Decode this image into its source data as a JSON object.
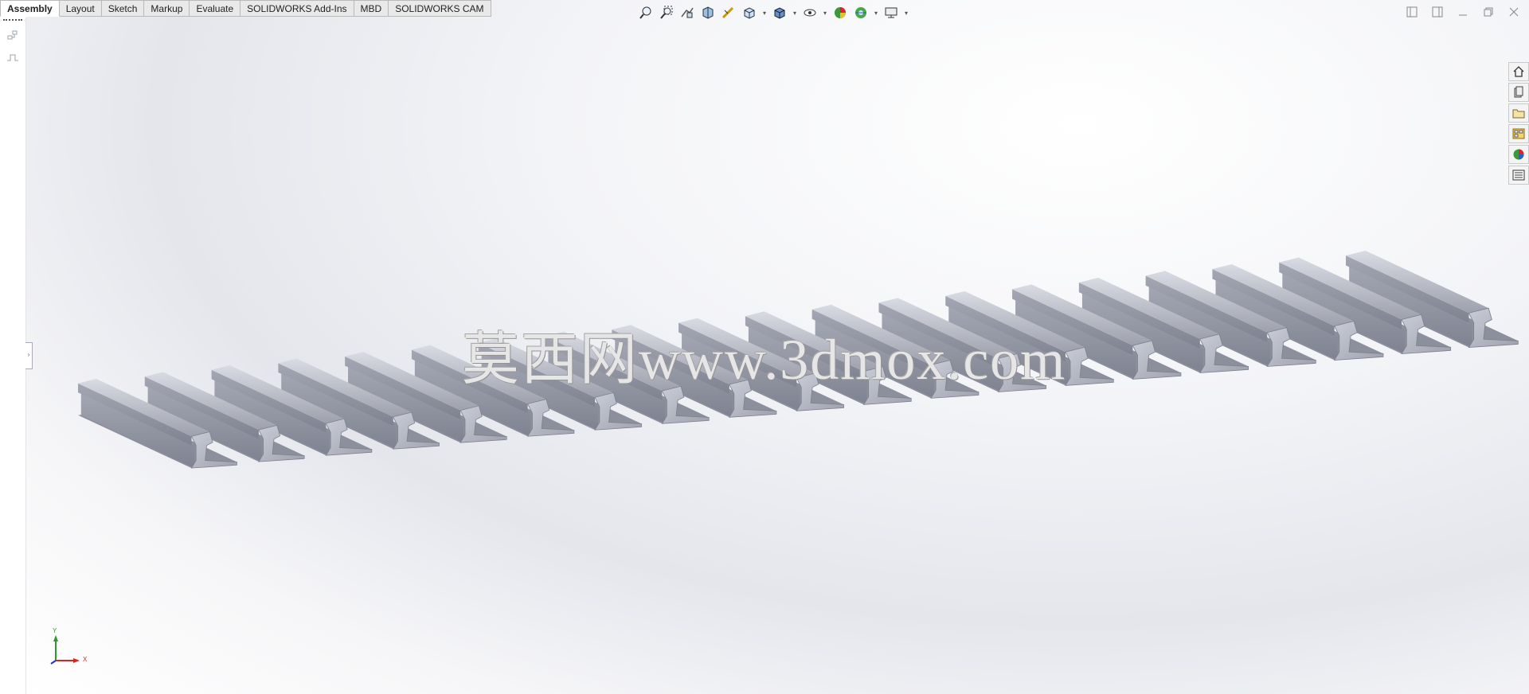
{
  "tabs": [
    {
      "label": "Assembly",
      "active": true
    },
    {
      "label": "Layout",
      "active": false
    },
    {
      "label": "Sketch",
      "active": false
    },
    {
      "label": "Markup",
      "active": false
    },
    {
      "label": "Evaluate",
      "active": false
    },
    {
      "label": "SOLIDWORKS Add-Ins",
      "active": false
    },
    {
      "label": "MBD",
      "active": false
    },
    {
      "label": "SOLIDWORKS CAM",
      "active": false
    }
  ],
  "hud_toolbar": [
    {
      "icon": "zoom-to-fit-icon"
    },
    {
      "icon": "zoom-to-area-icon"
    },
    {
      "icon": "previous-view-icon"
    },
    {
      "icon": "section-view-icon"
    },
    {
      "icon": "dynamic-annotation-views-icon"
    },
    {
      "icon": "view-orientation-icon",
      "dropdown": true
    },
    {
      "icon": "display-style-icon",
      "dropdown": true
    },
    {
      "icon": "hide-show-items-icon",
      "dropdown": true
    },
    {
      "icon": "edit-appearance-icon"
    },
    {
      "icon": "apply-scene-icon",
      "dropdown": true
    },
    {
      "icon": "view-settings-icon",
      "dropdown": true
    }
  ],
  "window_buttons": [
    "tile-left-icon",
    "tile-right-icon",
    "minimize-icon",
    "restore-icon",
    "close-icon"
  ],
  "task_pane": [
    "solidworks-resources-icon",
    "design-library-icon",
    "file-explorer-icon",
    "view-palette-icon",
    "appearances-scenes-icon",
    "custom-properties-icon"
  ],
  "scene": {
    "rail_count": 20,
    "watermark": "莫西网www.3dmox.com",
    "rail_color": "#b8bbc6"
  },
  "triad": {
    "y_label": "Y",
    "x_label": "X"
  }
}
